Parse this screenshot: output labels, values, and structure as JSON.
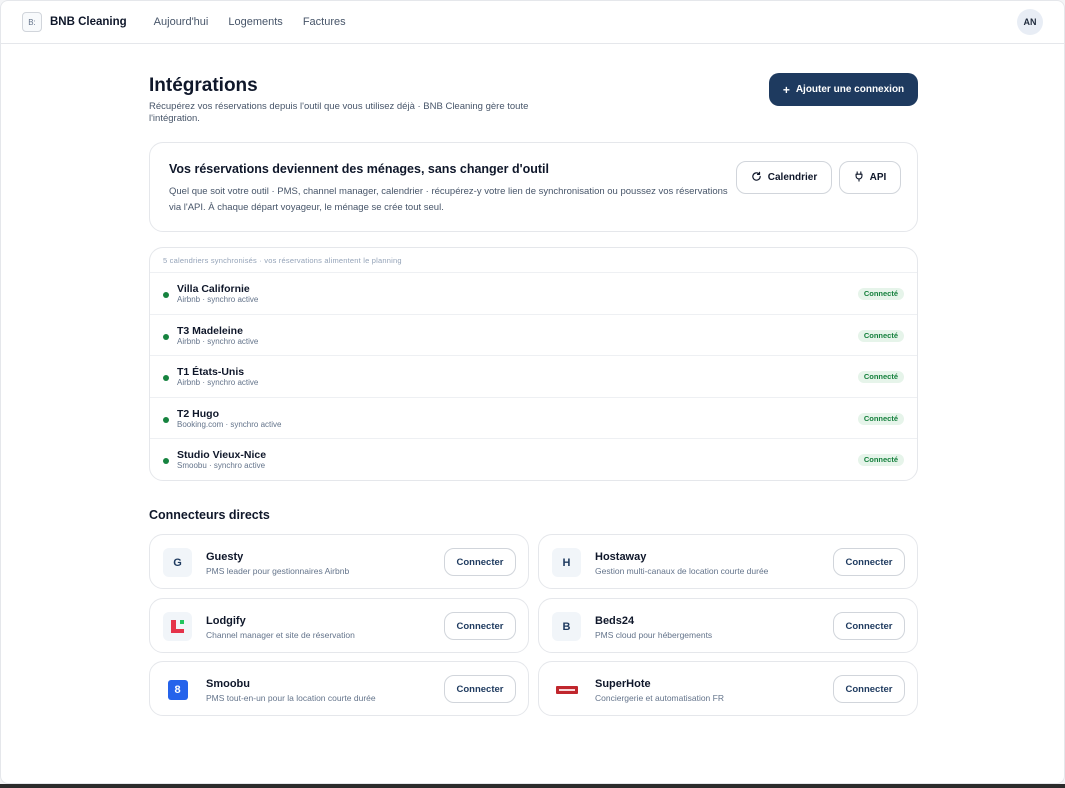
{
  "nav": {
    "brand_logo": "B:",
    "brand": "BNB Cleaning",
    "links": [
      "Aujourd'hui",
      "Logements",
      "Factures"
    ],
    "avatar": "AN"
  },
  "header": {
    "title": "Intégrations",
    "subtitle": "Récupérez vos réservations depuis l'outil que vous utilisez déjà · BNB Cleaning gère toute l'intégration.",
    "add_button": "Ajouter une connexion",
    "add_icon": "+"
  },
  "info": {
    "title": "Vos réservations deviennent des ménages, sans changer d'outil",
    "text": "Quel que soit votre outil · PMS, channel manager, calendrier · récupérez-y votre lien de synchronisation ou poussez vos réservations via l'API. À chaque départ voyageur, le ménage se crée tout seul.",
    "calendar_button": "Calendrier",
    "api_button": "API"
  },
  "calendars": {
    "header": "5 calendriers synchronisés · vos réservations alimentent le planning",
    "items": [
      {
        "name": "Villa Californie",
        "sub": "Airbnb · synchro active",
        "status": "Connecté"
      },
      {
        "name": "T3 Madeleine",
        "sub": "Airbnb · synchro active",
        "status": "Connecté"
      },
      {
        "name": "T1 États-Unis",
        "sub": "Airbnb · synchro active",
        "status": "Connecté"
      },
      {
        "name": "T2 Hugo",
        "sub": "Booking.com · synchro active",
        "status": "Connecté"
      },
      {
        "name": "Studio Vieux-Nice",
        "sub": "Smoobu · synchro active",
        "status": "Connecté"
      }
    ]
  },
  "connectors": {
    "title": "Connecteurs directs",
    "button": "Connecter",
    "items": [
      {
        "logo": "G",
        "name": "Guesty",
        "desc": "PMS leader pour gestionnaires Airbnb"
      },
      {
        "logo": "H",
        "name": "Hostaway",
        "desc": "Gestion multi-canaux de location courte durée"
      },
      {
        "logo": "",
        "name": "Lodgify",
        "desc": "Channel manager et site de réservation"
      },
      {
        "logo": "B",
        "name": "Beds24",
        "desc": "PMS cloud pour hébergements"
      },
      {
        "logo": "8",
        "name": "Smoobu",
        "desc": "PMS tout-en-un pour la location courte durée"
      },
      {
        "logo": "",
        "name": "SuperHote",
        "desc": "Conciergerie et automatisation FR"
      }
    ]
  },
  "colors": {
    "primary": "#1e3a5f",
    "success": "#15803d",
    "lodgify": "#e5334a",
    "smoobu": "#2563eb",
    "superhote": "#c0262d"
  }
}
